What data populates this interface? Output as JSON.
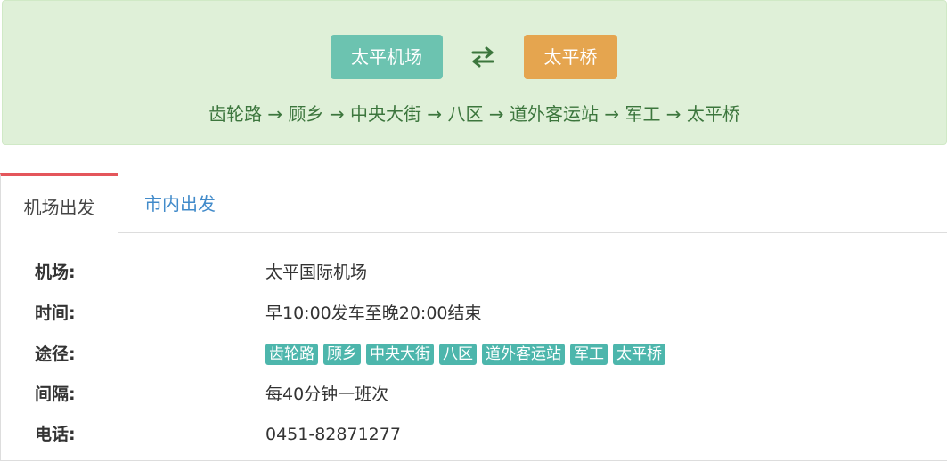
{
  "route": {
    "from": "太平机场",
    "to": "太平桥",
    "path_text": "齿轮路 → 顾乡 → 中央大街 → 八区 → 道外客运站 → 军工 → 太平桥",
    "swap_icon": "swap-arrows-icon"
  },
  "tabs": [
    {
      "label": "机场出发",
      "active": true
    },
    {
      "label": "市内出发",
      "active": false
    }
  ],
  "info": {
    "airport": {
      "label": "机场:",
      "value": "太平国际机场"
    },
    "time": {
      "label": "时间:",
      "value": "早10:00发车至晚20:00结束"
    },
    "route": {
      "label": "途径:",
      "stops": [
        "齿轮路",
        "顾乡",
        "中央大街",
        "八区",
        "道外客运站",
        "军工",
        "太平桥"
      ]
    },
    "interval": {
      "label": "间隔:",
      "value": "每40分钟一班次"
    },
    "phone": {
      "label": "电话:",
      "value": "0451-82871277"
    }
  },
  "colors": {
    "banner_bg": "#dff0d8",
    "from_btn": "#6cc3b0",
    "to_btn": "#e5a54f",
    "tab_accent": "#e4565b",
    "tag_bg": "#4db6ac",
    "link": "#428bca"
  }
}
